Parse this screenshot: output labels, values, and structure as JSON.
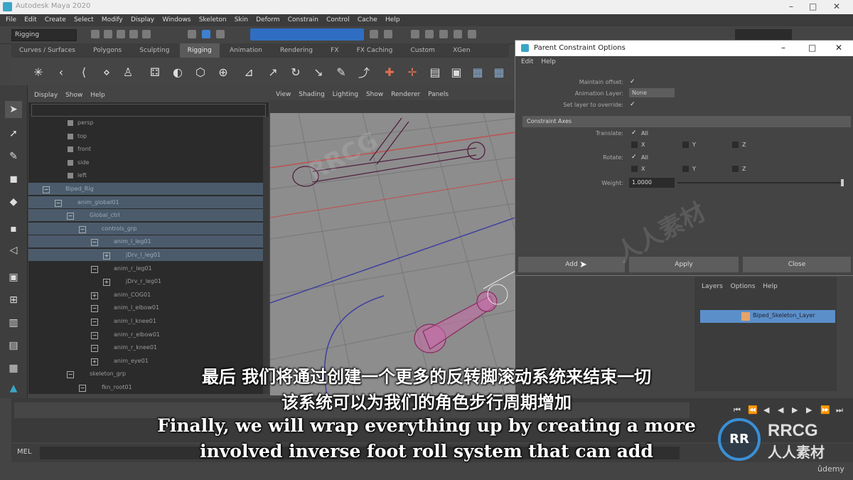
{
  "window": {
    "title": "Autodesk Maya 2020"
  },
  "menubar": [
    "File",
    "Edit",
    "Create",
    "Select",
    "Modify",
    "Display",
    "Windows",
    "Skeleton",
    "Skin",
    "Deform",
    "Constrain",
    "Control",
    "Cache",
    "Help"
  ],
  "status_line": {
    "mode": "Rigging"
  },
  "shelf_tabs": [
    "Curves / Surfaces",
    "Polygons",
    "Sculpting",
    "Rigging",
    "Animation",
    "Rendering",
    "FX",
    "FX Caching",
    "Custom",
    "XGen"
  ],
  "shelf_tabs_active": "Rigging",
  "outliner": {
    "menu": [
      "Display",
      "Show",
      "Help"
    ],
    "items": [
      {
        "label": "persp",
        "level": 1,
        "selected": false
      },
      {
        "label": "top",
        "level": 1,
        "selected": false
      },
      {
        "label": "front",
        "level": 1,
        "selected": false
      },
      {
        "label": "side",
        "level": 1,
        "selected": false
      },
      {
        "label": "left",
        "level": 1,
        "selected": false
      },
      {
        "label": "Biped_Rig",
        "level": 0,
        "selected": true
      },
      {
        "label": "anim_global01",
        "level": 1,
        "selected": true
      },
      {
        "label": "Global_ctrl",
        "level": 2,
        "selected": true
      },
      {
        "label": "controls_grp",
        "level": 3,
        "selected": true
      },
      {
        "label": "anim_l_leg01",
        "level": 4,
        "selected": true
      },
      {
        "label": "jDrv_l_leg01",
        "level": 5,
        "selected": true
      },
      {
        "label": "anim_r_leg01",
        "level": 4,
        "selected": false
      },
      {
        "label": "jDrv_r_leg01",
        "level": 5,
        "selected": false
      },
      {
        "label": "anim_COG01",
        "level": 4,
        "selected": false
      },
      {
        "label": "anim_l_elbow01",
        "level": 4,
        "selected": false
      },
      {
        "label": "anim_l_knee01",
        "level": 4,
        "selected": false
      },
      {
        "label": "anim_r_elbow01",
        "level": 4,
        "selected": false
      },
      {
        "label": "anim_r_knee01",
        "level": 4,
        "selected": false
      },
      {
        "label": "anim_eye01",
        "level": 4,
        "selected": false
      },
      {
        "label": "skeleton_grp",
        "level": 2,
        "selected": false
      },
      {
        "label": "fkn_root01",
        "level": 3,
        "selected": false
      }
    ]
  },
  "viewport": {
    "menu": [
      "View",
      "Shading",
      "Lighting",
      "Show",
      "Renderer",
      "Panels"
    ]
  },
  "dialog": {
    "title": "Parent Constraint Options",
    "menu": [
      "Edit",
      "Help"
    ],
    "maintain_offset_label": "Maintain offset:",
    "animation_layer_label": "Animation Layer:",
    "animation_layer_value": "None",
    "set_layer_label": "Set layer to override:",
    "section": "Constraint Axes",
    "translate_label": "Translate:",
    "rotate_label": "Rotate:",
    "all_label": "All",
    "x_label": "X",
    "y_label": "Y",
    "z_label": "Z",
    "weight_label": "Weight:",
    "weight_value": "1.0000",
    "buttons": {
      "add": "Add",
      "apply": "Apply",
      "close": "Close"
    }
  },
  "layer_editor": {
    "menu": [
      "Layers",
      "Options",
      "Help"
    ],
    "layer_name": "Biped_Skeleton_Layer"
  },
  "command_line": {
    "label": "MEL"
  },
  "subtitles": {
    "cn_line1": "最后 我们将通过创建一个更多的反转脚滚动系统来结束一切",
    "cn_line2": "该系统可以为我们的角色步行周期增加",
    "en_line1": "Finally, we will wrap everything up by creating a more",
    "en_line2": "involved inverse foot roll system that can add"
  },
  "watermark": {
    "logo": "RRCG",
    "logo_cn": "人人素材",
    "ring_text": "RR"
  },
  "udemy": "ûdemy",
  "colors": {
    "selection": "#4b5b6b",
    "layer_row": "#5b8fc9",
    "dialog_bg": "#444444"
  }
}
